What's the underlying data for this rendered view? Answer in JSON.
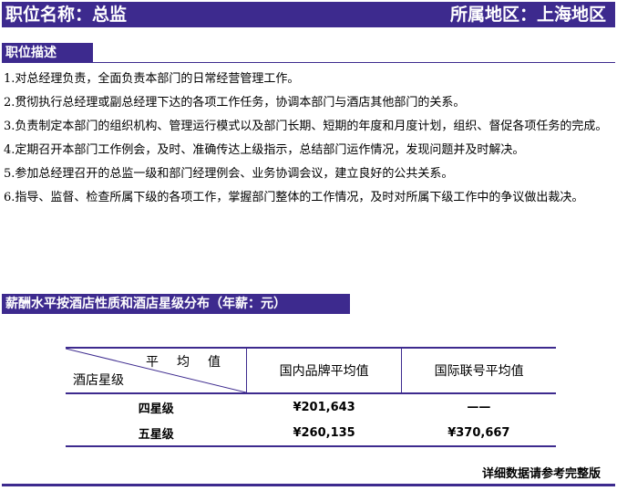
{
  "header": {
    "position_title": "职位名称：总监",
    "region": "所属地区：上海地区"
  },
  "description": {
    "heading": "职位描述",
    "items": [
      "1.对总经理负责，全面负责本部门的日常经营管理工作。",
      "2.贯彻执行总经理或副总经理下达的各项工作任务，协调本部门与酒店其他部门的关系。",
      "3.负责制定本部门的组织机构、管理运行模式以及部门长期、短期的年度和月度计划，组织、督促各项任务的完成。",
      "4.定期召开本部门工作例会，及时、准确传达上级指示，总结部门运作情况，发现问题并及时解决。",
      "5.参加总经理召开的总监一级和部门经理例会、业务协调会议，建立良好的公共关系。",
      "6.指导、监督、检查所属下级的各项工作，掌握部门整体的工作情况，及时对所属下级工作中的争议做出裁决。"
    ]
  },
  "salary": {
    "heading": "薪酬水平按酒店性质和酒店星级分布（年薪：元）",
    "diag_top": "平均值",
    "diag_bottom": "酒店星级",
    "columns": [
      "国内品牌平均值",
      "国际联号平均值"
    ],
    "rows": [
      {
        "label": "四星级",
        "domestic": "¥201,643",
        "international": "——"
      },
      {
        "label": "五星级",
        "domestic": "¥260,135",
        "international": "¥370,667"
      }
    ]
  },
  "footer": {
    "note": "详细数据请参考完整版"
  },
  "colors": {
    "accent": "#3d2a8e"
  }
}
